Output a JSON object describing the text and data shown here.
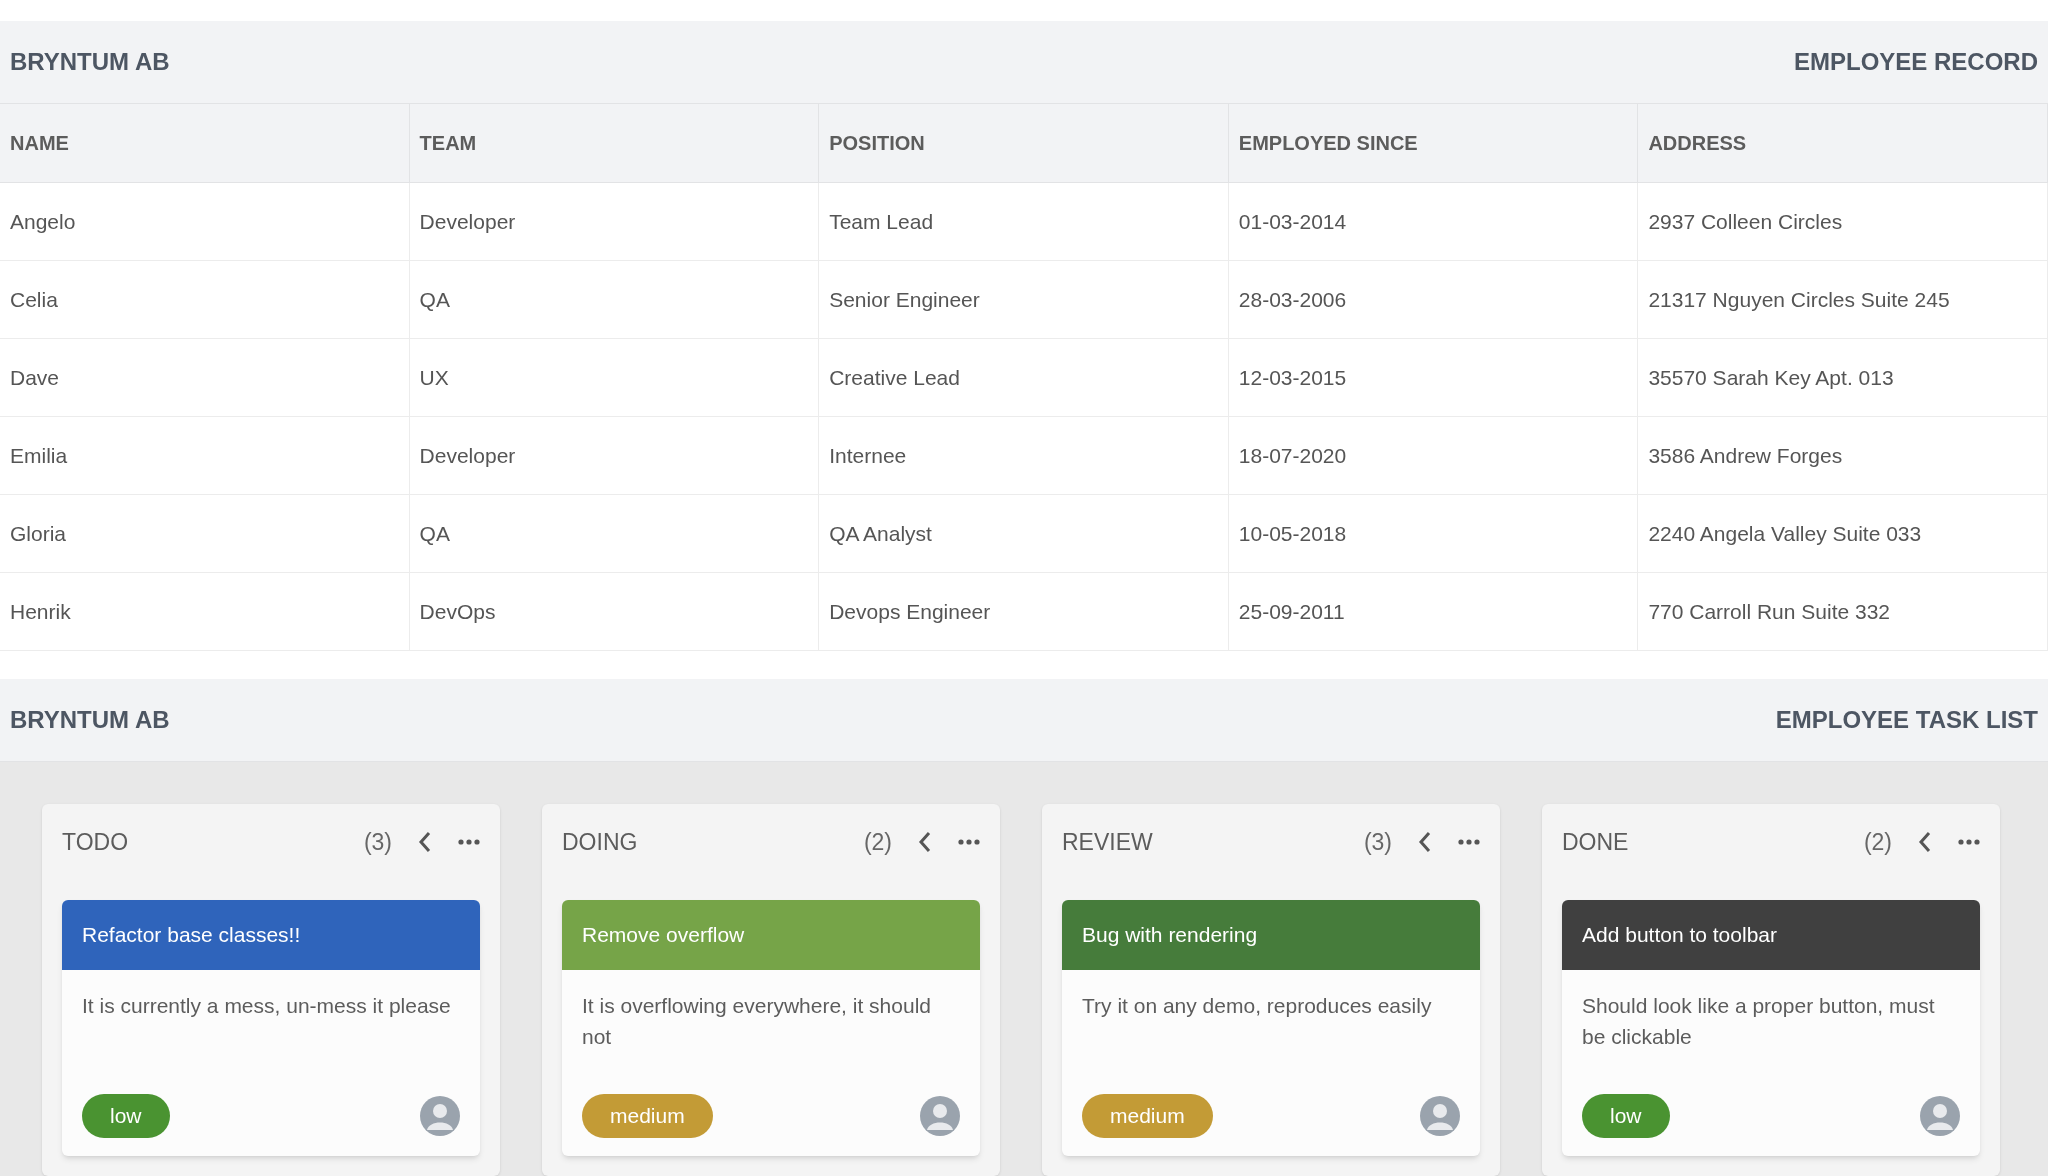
{
  "grid_panel": {
    "company": "BRYNTUM AB",
    "title": "EMPLOYEE RECORD",
    "columns": [
      "NAME",
      "TEAM",
      "POSITION",
      "EMPLOYED SINCE",
      "ADDRESS"
    ],
    "rows": [
      [
        "Angelo",
        "Developer",
        "Team Lead",
        "01-03-2014",
        "2937 Colleen Circles"
      ],
      [
        "Celia",
        "QA",
        "Senior Engineer",
        "28-03-2006",
        "21317 Nguyen Circles Suite 245"
      ],
      [
        "Dave",
        "UX",
        "Creative Lead",
        "12-03-2015",
        "35570 Sarah Key Apt. 013"
      ],
      [
        "Emilia",
        "Developer",
        "Internee",
        "18-07-2020",
        "3586 Andrew Forges"
      ],
      [
        "Gloria",
        "QA",
        "QA Analyst",
        "10-05-2018",
        "2240 Angela Valley Suite 033"
      ],
      [
        "Henrik",
        "DevOps",
        "Devops Engineer",
        "25-09-2011",
        "770 Carroll Run Suite 332"
      ]
    ]
  },
  "task_panel": {
    "company": "BRYNTUM AB",
    "title": "EMPLOYEE TASK LIST",
    "columns": [
      {
        "title": "TODO",
        "count": "(3)",
        "cards": [
          {
            "title": "Refactor base classes!!",
            "color": "#2f64bb",
            "description": "It is currently a mess, un-mess it please",
            "priority": {
              "text": "low",
              "color": "#4a9331"
            }
          }
        ]
      },
      {
        "title": "DOING",
        "count": "(2)",
        "cards": [
          {
            "title": "Remove overflow",
            "color": "#76a448",
            "description": "It is overflowing everywhere, it should not",
            "priority": {
              "text": "medium",
              "color": "#c39b36"
            }
          }
        ]
      },
      {
        "title": "REVIEW",
        "count": "(3)",
        "cards": [
          {
            "title": "Bug with rendering",
            "color": "#467c3b",
            "description": "Try it on any demo, reproduces easily",
            "priority": {
              "text": "medium",
              "color": "#c39b36"
            }
          }
        ]
      },
      {
        "title": "DONE",
        "count": "(2)",
        "cards": [
          {
            "title": "Add button to toolbar",
            "color": "#404040",
            "description": "Should look like a proper button, must be clickable",
            "priority": {
              "text": "low",
              "color": "#4a9331"
            }
          }
        ]
      }
    ]
  }
}
